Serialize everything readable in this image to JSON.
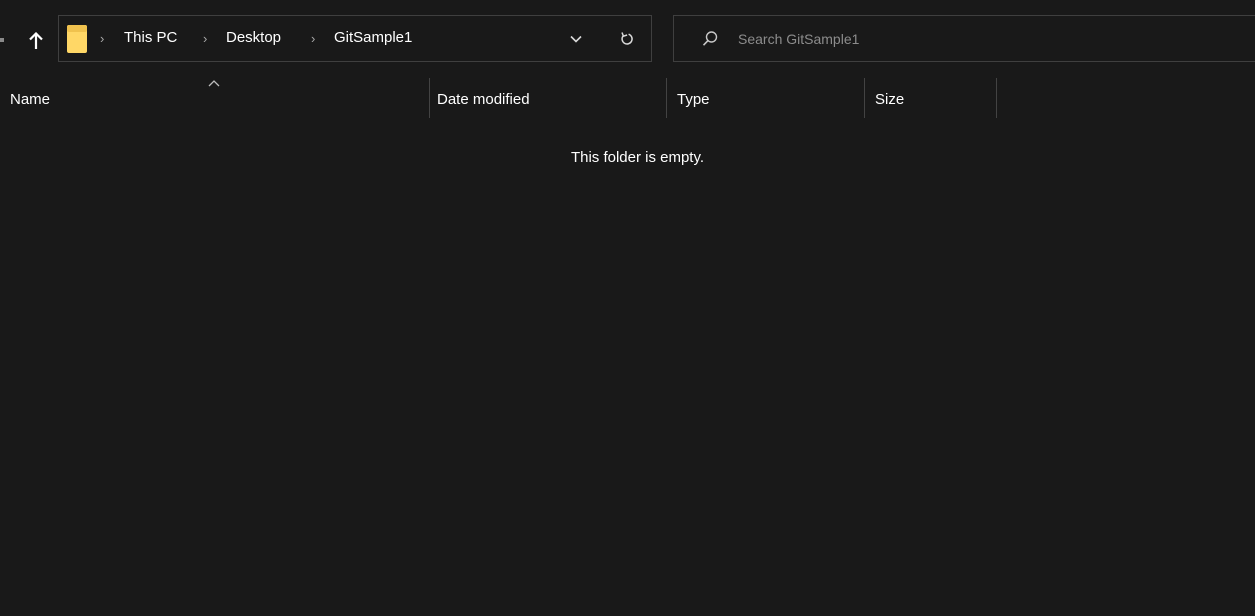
{
  "colors": {
    "background": "#191919",
    "border": "#3f3f3f",
    "text": "#ffffff",
    "muted_text": "#8c8c8c",
    "folder_yellow": "#ffd766"
  },
  "toolbar": {
    "up_icon": "arrow-up-icon",
    "breadcrumbs": [
      {
        "label": "This PC"
      },
      {
        "label": "Desktop"
      },
      {
        "label": "GitSample1"
      }
    ],
    "dropdown_icon": "chevron-down-icon",
    "refresh_icon": "refresh-icon"
  },
  "search": {
    "placeholder": "Search GitSample1",
    "value": "",
    "icon": "search-icon"
  },
  "columns": [
    {
      "label": "Name",
      "sorted": "ascending"
    },
    {
      "label": "Date modified"
    },
    {
      "label": "Type"
    },
    {
      "label": "Size"
    }
  ],
  "content": {
    "empty_message": "This folder is empty."
  }
}
